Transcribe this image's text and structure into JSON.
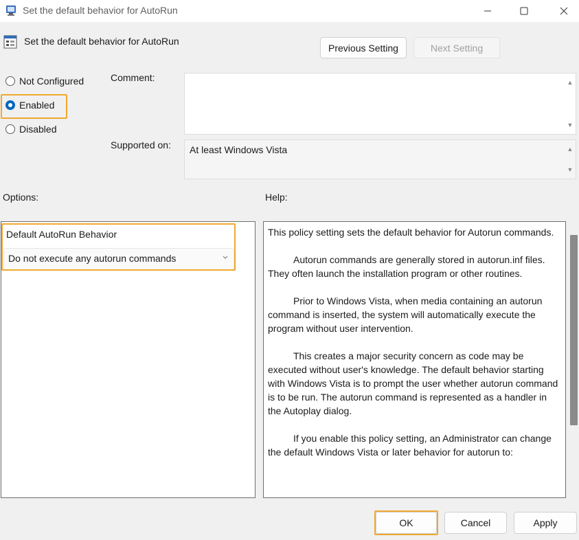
{
  "window": {
    "title": "Set the default behavior for AutoRun",
    "controls": [
      "minimize-icon",
      "maximize-icon",
      "close-icon"
    ]
  },
  "header": {
    "title": "Set the default behavior for AutoRun",
    "previous_label": "Previous Setting",
    "next_label": "Next Setting"
  },
  "state": {
    "options": [
      {
        "label": "Not Configured",
        "checked": false
      },
      {
        "label": "Enabled",
        "checked": true
      },
      {
        "label": "Disabled",
        "checked": false
      }
    ]
  },
  "comment": {
    "label": "Comment:",
    "value": ""
  },
  "supported": {
    "label": "Supported on:",
    "value": "At least Windows Vista"
  },
  "options_panel": {
    "label": "Options:",
    "field_label": "Default AutoRun Behavior",
    "selected": "Do not execute any autorun commands"
  },
  "help": {
    "label": "Help:",
    "paragraphs": [
      "This policy setting sets the default behavior for Autorun commands.",
      "Autorun commands are generally stored in autorun.inf files. They often launch the installation program or other routines.",
      "Prior to Windows Vista, when media containing an autorun command is inserted, the system will automatically execute the program without user intervention.",
      "This creates a major security concern as code may be executed without user's knowledge. The default behavior starting with Windows Vista is to prompt the user whether autorun command is to be run. The autorun command is represented as a handler in the Autoplay dialog.",
      "If you enable this policy setting, an Administrator can change the default Windows Vista or later behavior for autorun to:"
    ]
  },
  "footer": {
    "ok_label": "OK",
    "cancel_label": "Cancel",
    "apply_label": "Apply"
  },
  "colors": {
    "accent": "#0067c0",
    "highlight": "#f0a830"
  }
}
